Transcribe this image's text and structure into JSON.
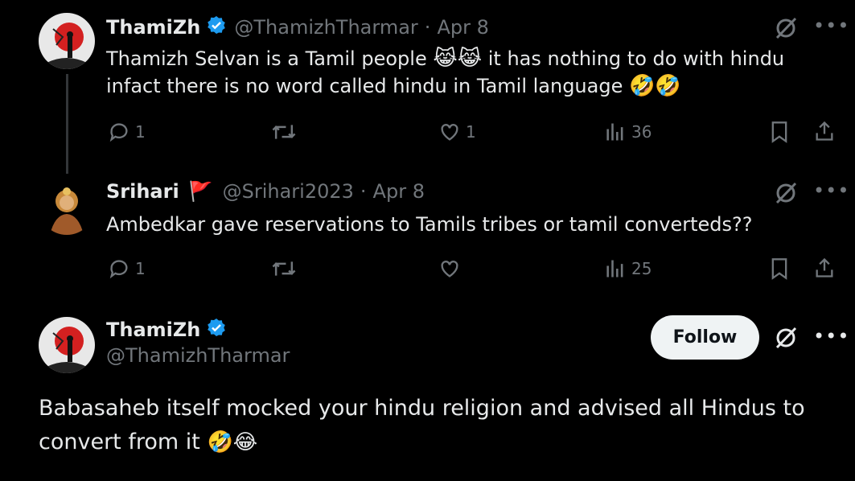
{
  "posts": [
    {
      "name": "ThamiZh",
      "handle": "@ThamizhTharmar",
      "date": "Apr 8",
      "text_line1": "Thamizh Selvan is a Tamil people",
      "emoji_line1": "😹😹",
      "text_line1b": "it has nothing to do with hindu",
      "text_line2": "infact there is no word called hindu in Tamil language",
      "emoji_line2": "🤣🤣",
      "replies": "1",
      "likes": "1",
      "views": "36"
    },
    {
      "name": "Srihari",
      "flag": "🚩",
      "handle": "@Srihari2023",
      "date": "Apr 8",
      "text": "Ambedkar gave reservations to Tamils tribes or tamil converteds??",
      "replies": "1",
      "views": "25"
    }
  ],
  "main_post": {
    "name": "ThamiZh",
    "handle": "@ThamizhTharmar",
    "follow_label": "Follow",
    "text": "Babasaheb itself mocked your hindu religion and advised all Hindus to convert from it",
    "emoji": "🤣😂"
  },
  "colors": {
    "background": "#000000",
    "text": "#e7e9ea",
    "muted": "#71767b",
    "verified": "#1d9bf0"
  }
}
